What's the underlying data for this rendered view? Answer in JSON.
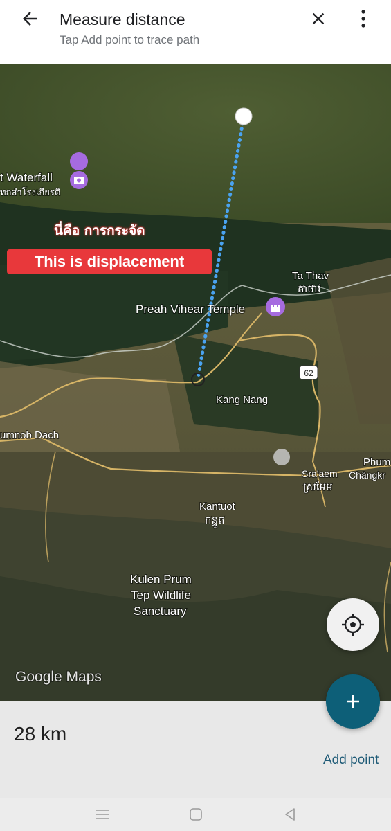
{
  "header": {
    "title": "Measure distance",
    "subtitle": "Tap Add point to trace path",
    "back_icon": "arrow-back-icon",
    "close_icon": "close-icon",
    "more_icon": "more-vert-icon"
  },
  "map": {
    "labels": {
      "waterfall": "t Waterfall",
      "waterfall_thai": "ทกสำโรงเกียรติ",
      "ta_thav": "Ta Thav",
      "ta_thav_khmer": "តាថាវ",
      "preah_vihear": "Preah Vihear Temple",
      "kang_nang": "Kang Nang",
      "route": "62",
      "umnob_dach": "umnob Dach",
      "sraaem": "Sra'aem",
      "sraaem_khmer": "ស្រអែម",
      "phum": "Phum",
      "changkr": "Chângkr",
      "kantuot": "Kantuot",
      "kantuot_khmer": "កន្ទួត",
      "kulen_1": "Kulen Prum",
      "kulen_2": "Tep Wildlife",
      "kulen_3": "Sanctuary",
      "watermark": "Google Maps"
    },
    "annotation_thai": "นี่คือ การกระจัด",
    "annotation_en": "This is displacement",
    "colors": {
      "measure_line": "#4aa3f0",
      "road": "#d6b466",
      "poi_purple": "#a66be0",
      "annotation_red": "#e8383b"
    }
  },
  "bottom_sheet": {
    "distance": "28 km",
    "add_point_label": "Add point"
  },
  "fab": {
    "add_icon": "plus-icon",
    "location_icon": "my-location-icon"
  },
  "navbar": {
    "menu_icon": "recents-icon",
    "home_icon": "home-icon",
    "back_icon": "nav-back-icon"
  }
}
